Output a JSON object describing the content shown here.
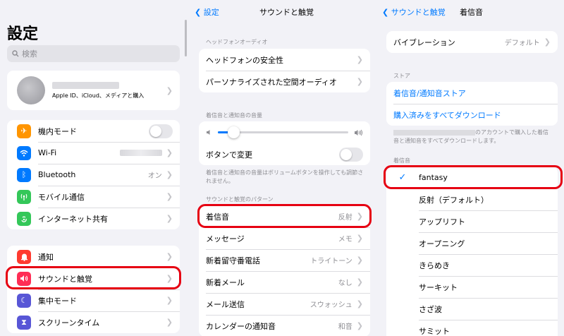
{
  "settings": {
    "title": "設定",
    "search_placeholder": "検索",
    "account_subtitle": "Apple ID、iCloud、メディアと購入",
    "group1": [
      {
        "label": "機内モード",
        "icon": "airplane-icon",
        "color": "#ff9500"
      },
      {
        "label": "Wi-Fi",
        "icon": "wifi-icon",
        "color": "#007aff"
      },
      {
        "label": "Bluetooth",
        "icon": "bluetooth-icon",
        "color": "#007aff",
        "value": "オン"
      },
      {
        "label": "モバイル通信",
        "icon": "antenna-icon",
        "color": "#34c759"
      },
      {
        "label": "インターネット共有",
        "icon": "hotspot-icon",
        "color": "#34c759"
      }
    ],
    "group2": [
      {
        "label": "通知",
        "icon": "bell-icon",
        "color": "#ff3b30"
      },
      {
        "label": "サウンドと触覚",
        "icon": "speaker-icon",
        "color": "#ff2d55"
      },
      {
        "label": "集中モード",
        "icon": "moon-icon",
        "color": "#5856d6"
      },
      {
        "label": "スクリーンタイム",
        "icon": "hourglass-icon",
        "color": "#5856d6"
      }
    ]
  },
  "sounds": {
    "back_label": "設定",
    "title": "サウンドと触覚",
    "headphone_header": "ヘッドフォンオーディオ",
    "headphone_rows": [
      "ヘッドフォンの安全性",
      "パーソナライズされた空間オーディオ"
    ],
    "volume_header": "着信音と通知音の音量",
    "volume_level": 0.12,
    "change_with_buttons": "ボタンで変更",
    "volume_note": "着信音と通知音の音量はボリュームボタンを操作しても調節されません。",
    "patterns_header": "サウンドと触覚のパターン",
    "patterns": [
      {
        "label": "着信音",
        "value": "反射"
      },
      {
        "label": "メッセージ",
        "value": "メモ"
      },
      {
        "label": "新着留守番電話",
        "value": "トライトーン"
      },
      {
        "label": "新着メール",
        "value": "なし"
      },
      {
        "label": "メール送信",
        "value": "スウォッシュ"
      },
      {
        "label": "カレンダーの通知音",
        "value": "和音"
      }
    ]
  },
  "ringtone": {
    "back_label": "サウンドと触覚",
    "title": "着信音",
    "vibration_label": "バイブレーション",
    "vibration_value": "デフォルト",
    "store_header": "ストア",
    "store_links": [
      "着信音/通知音ストア",
      "購入済みをすべてダウンロード"
    ],
    "store_note_line1": "のアカウントで購入した着信",
    "store_note_line2": "音と通知音をすべてダウンロードします。",
    "tones_header": "着信音",
    "check_mark": "✓",
    "tones": [
      "fantasy",
      "反射（デフォルト）",
      "アップリフト",
      "オープニング",
      "きらめき",
      "サーキット",
      "さざ波",
      "サミット"
    ],
    "selected_index": 0
  },
  "colors": {
    "accent": "#007aff",
    "highlight": "#e60012"
  }
}
